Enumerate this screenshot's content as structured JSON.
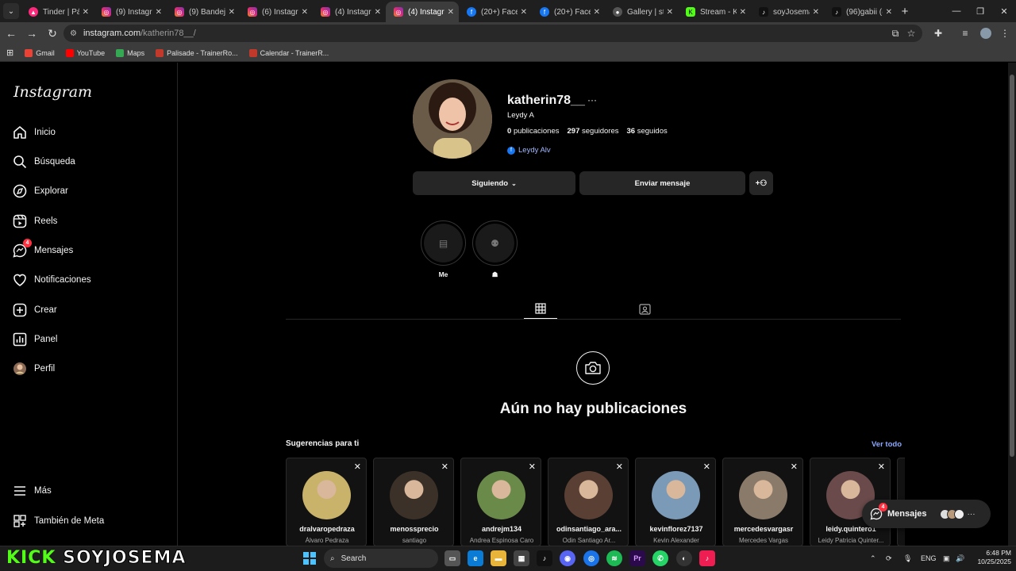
{
  "browser": {
    "tabs": [
      {
        "title": "Tinder | Pág",
        "icon": "tinder"
      },
      {
        "title": "(9) Instagram",
        "icon": "instagram"
      },
      {
        "title": "(9) Bandeja",
        "icon": "instagram"
      },
      {
        "title": "(6) Instagram",
        "icon": "instagram"
      },
      {
        "title": "(4) Instagram",
        "icon": "instagram"
      },
      {
        "title": "(4) Instagram",
        "icon": "instagram",
        "active": true
      },
      {
        "title": "(20+) Facebo",
        "icon": "facebook"
      },
      {
        "title": "(20+) Facebo",
        "icon": "facebook"
      },
      {
        "title": "Gallery | stel",
        "icon": "generic"
      },
      {
        "title": "Stream - Kic",
        "icon": "kick"
      },
      {
        "title": "soyJosema",
        "icon": "tiktok"
      },
      {
        "title": "(96)gabii (@",
        "icon": "tiktok"
      }
    ],
    "url_host": "instagram.com",
    "url_path": "/katherin78__/",
    "bookmarks": [
      {
        "label": "Gmail",
        "icon": "gmail",
        "color": "#ea4335"
      },
      {
        "label": "YouTube",
        "icon": "youtube",
        "color": "#ff0000"
      },
      {
        "label": "Maps",
        "icon": "maps",
        "color": "#34a853"
      },
      {
        "label": "Palisade - TrainerRo...",
        "icon": "trainer",
        "color": "#c0392b"
      },
      {
        "label": "Calendar - TrainerR...",
        "icon": "trainer",
        "color": "#c0392b"
      }
    ]
  },
  "sidebar": {
    "logo": "Instagram",
    "items": [
      {
        "label": "Inicio",
        "icon": "home-icon"
      },
      {
        "label": "Búsqueda",
        "icon": "search-icon"
      },
      {
        "label": "Explorar",
        "icon": "compass-icon"
      },
      {
        "label": "Reels",
        "icon": "reels-icon"
      },
      {
        "label": "Mensajes",
        "icon": "messenger-icon",
        "badge": "4"
      },
      {
        "label": "Notificaciones",
        "icon": "heart-icon"
      },
      {
        "label": "Crear",
        "icon": "plus-square-icon"
      },
      {
        "label": "Panel",
        "icon": "chart-icon"
      },
      {
        "label": "Perfil",
        "icon": "avatar-icon"
      }
    ],
    "more": "Más",
    "meta": "También de Meta"
  },
  "profile": {
    "username": "katherin78__",
    "full_name": "Leydy A",
    "posts_count": "0",
    "posts_label": "publicaciones",
    "followers_count": "297",
    "followers_label": "seguidores",
    "following_count": "36",
    "following_label": "seguidos",
    "facebook_link": "Leydy Alv",
    "following_button": "Siguiendo",
    "message_button": "Enviar mensaje",
    "highlights": [
      {
        "label": "Me"
      },
      {
        "label": "☗"
      }
    ],
    "empty_title": "Aún no hay publicaciones"
  },
  "suggestions": {
    "title": "Sugerencias para ti",
    "see_all": "Ver todo",
    "cards": [
      {
        "username": "dralvaropedraza",
        "name": "Álvaro Pedraza",
        "color": "#c9b26a"
      },
      {
        "username": "menossprecio",
        "name": "santiago",
        "color": "#3b3129"
      },
      {
        "username": "andrejm134",
        "name": "Andrea Espinosa Caro",
        "color": "#6a8a4a"
      },
      {
        "username": "odinsantiago_ara...",
        "name": "Odin Santiago Ar...",
        "color": "#5a4034"
      },
      {
        "username": "kevinflorez7137",
        "name": "Kevin Alexander",
        "color": "#7a9ab8"
      },
      {
        "username": "mercedesvargasr",
        "name": "Mercedes Vargas",
        "color": "#8a7a6a"
      },
      {
        "username": "leidy.quintero1",
        "name": "Leidy Patricia Quinter...",
        "color": "#6a4a4a"
      }
    ]
  },
  "messages_float": {
    "label": "Mensajes",
    "badge": "4"
  },
  "taskbar": {
    "overlay_kick": "KICK",
    "overlay_name": "SOYJOSEMA",
    "search_label": "Search",
    "language": "ENG",
    "time": "6:48 PM",
    "date": "10/25/2025"
  }
}
